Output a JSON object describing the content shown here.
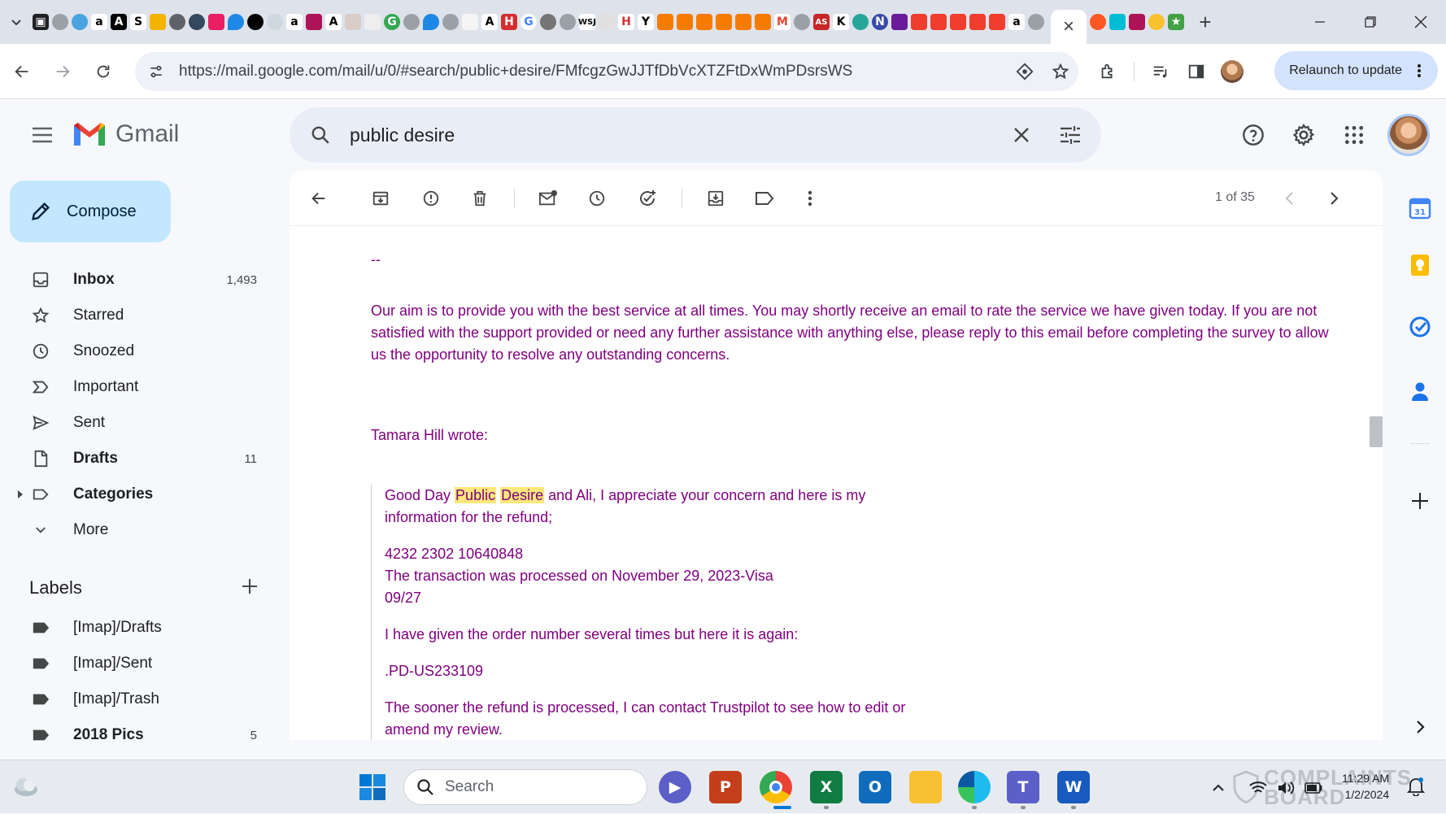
{
  "browser": {
    "url": "https://mail.google.com/mail/u/0/#search/public+desire/FMfcgzGwJJTfDbVcXTZFtDxWmPDsrsWS",
    "relaunch_label": "Relaunch to update",
    "active_tab_close": "×",
    "new_tab": "+"
  },
  "gmail": {
    "logo_text": "Gmail",
    "search_value": "public desire",
    "compose_label": "Compose"
  },
  "nav": {
    "items": [
      {
        "label": "Inbox",
        "count": "1,493",
        "icon": "inbox-icon",
        "bold": true
      },
      {
        "label": "Starred",
        "count": "",
        "icon": "star-icon",
        "bold": false
      },
      {
        "label": "Snoozed",
        "count": "",
        "icon": "clock-icon",
        "bold": false
      },
      {
        "label": "Important",
        "count": "",
        "icon": "important-icon",
        "bold": false
      },
      {
        "label": "Sent",
        "count": "",
        "icon": "send-icon",
        "bold": false
      },
      {
        "label": "Drafts",
        "count": "11",
        "icon": "draft-icon",
        "bold": true
      },
      {
        "label": "Categories",
        "count": "",
        "icon": "label-icon",
        "bold": true
      },
      {
        "label": "More",
        "count": "",
        "icon": "chevron-down-icon",
        "bold": false
      }
    ]
  },
  "labels": {
    "heading": "Labels",
    "items": [
      {
        "label": "[Imap]/Drafts",
        "count": ""
      },
      {
        "label": "[Imap]/Sent",
        "count": ""
      },
      {
        "label": "[Imap]/Trash",
        "count": ""
      },
      {
        "label": "2018 Pics",
        "count": "5"
      }
    ]
  },
  "toolbar": {
    "pager": "1 of 35"
  },
  "message": {
    "separator": "--",
    "paragraph": "Our aim is to provide you with the best service at all times. You may shortly receive an email to rate the service we have given today. If you are not satisfied with the support provided or need any further assistance with anything else, please reply to this email before completing the survey to allow us the opportunity to resolve any outstanding concerns.",
    "attribution": "Tamara Hill wrote:",
    "quoted": {
      "greeting_pre": "Good Day ",
      "highlight_1": "Public",
      "highlight_2": "Desire",
      "greeting_post": " and Ali, I appreciate your concern and here is my information for the refund;",
      "card_line": "4232 2302 10640848",
      "transaction_line": "The transaction was processed on November 29, 2023-Visa",
      "expiry_line": "09/27",
      "order_intro": "I have given the order number several times but here it is again:",
      "order_number": ".PD-US233109",
      "closing": "The sooner the refund is processed, I can contact Trustpilot to see how to edit or amend my review."
    }
  },
  "taskbar": {
    "search_label": "Search",
    "clock_time": "11:29 AM",
    "clock_date": "1/2/2024",
    "watermark_line1": "COMPLAINTS",
    "watermark_line2": "BOARD"
  },
  "colors": {
    "accent": "#0b57d0",
    "compose_bg": "#c2e7ff",
    "quote_text": "#800080",
    "highlight": "#fbe77a"
  }
}
